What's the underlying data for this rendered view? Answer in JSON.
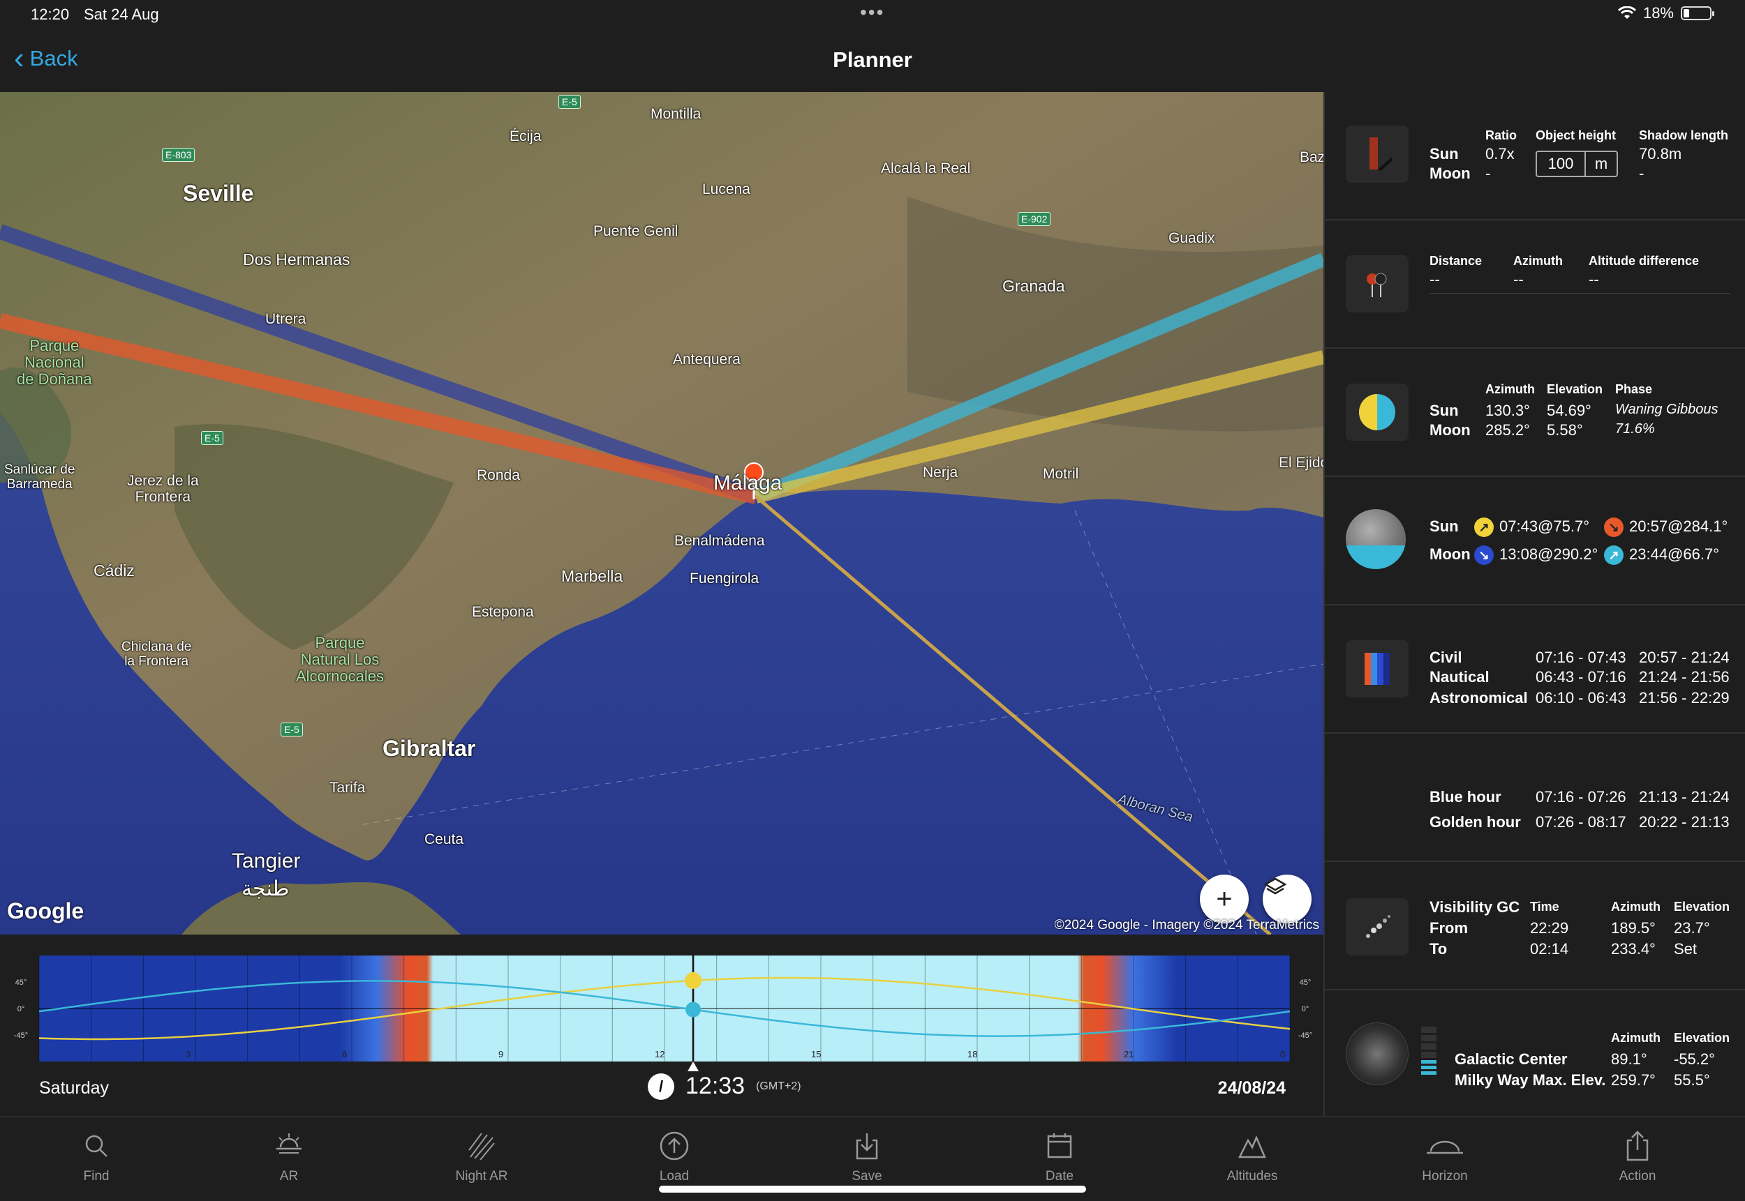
{
  "status": {
    "time": "12:20",
    "date": "Sat 24 Aug",
    "battery": "18%"
  },
  "nav": {
    "back_label": "Back",
    "title": "Planner"
  },
  "map": {
    "places": {
      "ecija": "Écija",
      "montilla": "Montilla",
      "seville": "Seville",
      "dos_hermanas": "Dos Hermanas",
      "lucena": "Lucena",
      "alcala": "Alcalá la Real",
      "baz": "Baz",
      "puente_genil": "Puente Genil",
      "guadix": "Guadix",
      "granada": "Granada",
      "utrera": "Utrera",
      "antequera": "Antequera",
      "sanlucar": "Sanlúcar de\nBarrameda",
      "jerez": "Jerez de la\nFrontera",
      "ronda": "Ronda",
      "malaga": "Málaga",
      "nerja": "Nerja",
      "motril": "Motril",
      "el_ejido": "El Ejido",
      "benalmadena": "Benalmádena",
      "marbella": "Marbella",
      "fuengirola": "Fuengirola",
      "cadiz": "Cádiz",
      "estepona": "Estepona",
      "chiclana": "Chiclana de\nla Frontera",
      "gibraltar": "Gibraltar",
      "tarifa": "Tarifa",
      "ceuta": "Ceuta",
      "tangier": "Tangier",
      "tangier_ar": "طنجة",
      "alboran": "Alboran Sea",
      "donana": "Parque\nNacional\nde Doñana",
      "alcornocales": "Parque\nNatural Los\nAlcornocales"
    },
    "roads": {
      "e5a": "E-5",
      "e803": "E-803",
      "e902": "E-902",
      "e5b": "E-5",
      "e5c": "E-5"
    },
    "google_logo": "Google",
    "copyright": "©2024 Google - Imagery ©2024 TerraMetrics"
  },
  "timeline": {
    "hour_labels": [
      "3",
      "6",
      "9",
      "12",
      "15",
      "18",
      "21",
      "0"
    ],
    "axis_left": [
      "45°",
      "0°",
      "-45°"
    ],
    "axis_right": [
      "45°",
      "0°",
      "-45°"
    ],
    "day": "Saturday",
    "time": "12:33",
    "tz": "(GMT+2)",
    "date": "24/08/24",
    "now_hour": 12.55
  },
  "panel": {
    "shadow": {
      "sun": "Sun",
      "moon": "Moon",
      "ratio_hd": "Ratio",
      "ratio_sun": "0.7x",
      "ratio_moon": "-",
      "height_hd": "Object height",
      "height_val": "100",
      "height_unit": "m",
      "shadow_hd": "Shadow length",
      "shadow_sun": "70.8m",
      "shadow_moon": "-"
    },
    "geodetic": {
      "distance_hd": "Distance",
      "distance": "--",
      "azimuth_hd": "Azimuth",
      "azimuth": "--",
      "alt_hd": "Altitude difference",
      "alt": "--"
    },
    "position": {
      "sun": "Sun",
      "moon": "Moon",
      "az_hd": "Azimuth",
      "el_hd": "Elevation",
      "phase_hd": "Phase",
      "sun_az": "130.3°",
      "sun_el": "54.69°",
      "moon_az": "285.2°",
      "moon_el": "5.58°",
      "phase": "Waning Gibbous",
      "illum": "71.6%"
    },
    "riseset": {
      "sun": "Sun",
      "moon": "Moon",
      "sunrise": "07:43@75.7°",
      "sunset": "20:57@284.1°",
      "moonset": "13:08@290.2°",
      "moonrise": "23:44@66.7°"
    },
    "twilight": {
      "civil": "Civil",
      "nautical": "Nautical",
      "astro": "Astronomical",
      "civil_am": "07:16 - 07:43",
      "civil_pm": "20:57 - 21:24",
      "naut_am": "06:43 - 07:16",
      "naut_pm": "21:24 - 21:56",
      "astro_am": "06:10 - 06:43",
      "astro_pm": "21:56 - 22:29"
    },
    "hours": {
      "blue": "Blue hour",
      "golden": "Golden hour",
      "blue_am": "07:16 - 07:26",
      "blue_pm": "21:13 - 21:24",
      "golden_am": "07:26 - 08:17",
      "golden_pm": "20:22 - 21:13"
    },
    "visibility": {
      "title": "Visibility GC",
      "from": "From",
      "to": "To",
      "time_hd": "Time",
      "az_hd": "Azimuth",
      "el_hd": "Elevation",
      "from_time": "22:29",
      "from_az": "189.5°",
      "from_el": "23.7°",
      "to_time": "02:14",
      "to_az": "233.4°",
      "to_el": "Set"
    },
    "galactic": {
      "gc": "Galactic Center",
      "mw": "Milky Way Max. Elev.",
      "az_hd": "Azimuth",
      "el_hd": "Elevation",
      "gc_az": "89.1°",
      "gc_el": "-55.2°",
      "mw_az": "259.7°",
      "mw_el": "55.5°"
    }
  },
  "tabs": [
    "Find",
    "AR",
    "Night AR",
    "Load",
    "Save",
    "Date",
    "Altitudes",
    "Horizon",
    "Action"
  ],
  "colors": {
    "accent": "#35a8e0",
    "sun_line": "#e8c840",
    "moon_line": "#3ab8d8",
    "sunset_line": "#e8582a",
    "moonset_line": "#3040a0"
  }
}
